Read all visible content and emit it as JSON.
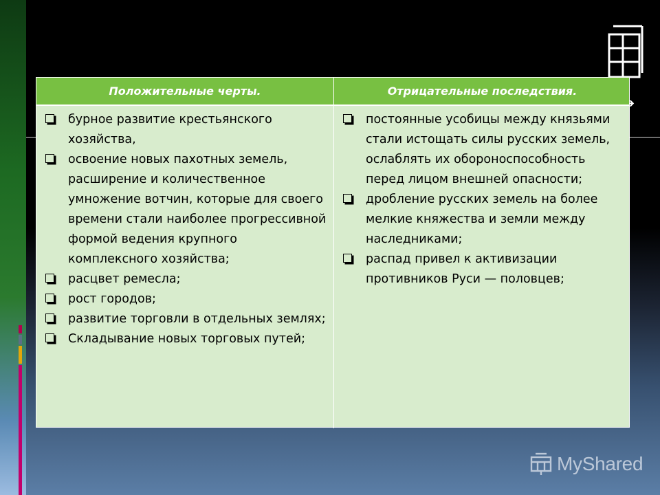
{
  "table": {
    "columns": [
      {
        "header": "Положительные черты.",
        "items": [
          "бурное развитие крестьянского хозяйства,",
          "освоение новых пахотных земель, расширение и количественное умножение вотчин, которые для своего времени стали наиболее прогрессивной формой ведения крупного комплексного хозяйства;",
          "расцвет ремесла;",
          "рост городов;",
          "развитие торговли в отдельных землях;",
          "Складывание новых торговых путей;"
        ]
      },
      {
        "header": "Отрицательные последствия.",
        "items": [
          "постоянные усобицы между князьями стали истощать силы русских земель, ослаблять их обороноспособность перед лицом внешней опасности;",
          "дробление русских земель на более мелкие княжества и земли между наследниками;",
          "распад привел к активизации противников Руси — половцев;"
        ]
      }
    ]
  },
  "logo": {
    "text": "MyShared",
    "icon": "presentation-board-icon"
  },
  "colors": {
    "header_bg": "#78c042",
    "body_bg": "#d8eccd",
    "accent_pink": "#c2006b",
    "accent_yellow": "#e3a60a"
  },
  "icons": {
    "bullet": "checkbox-bullet-icon",
    "arrow": "arrow-right-icon",
    "decor": "window-frame-icon"
  }
}
